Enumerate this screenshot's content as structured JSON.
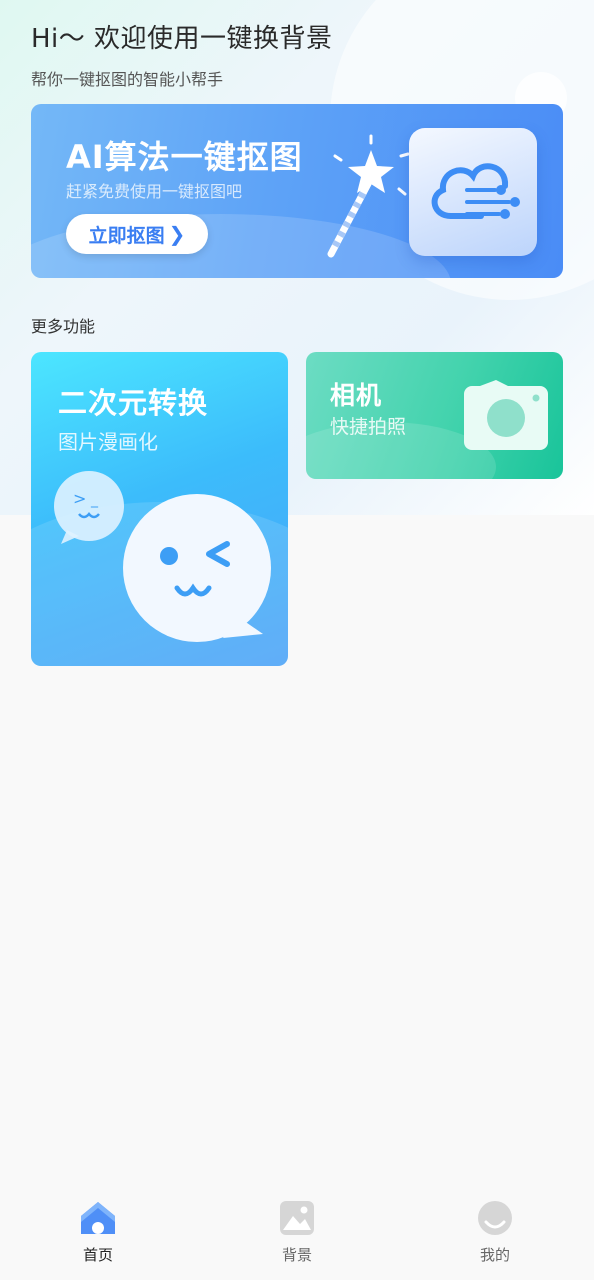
{
  "header": {
    "greeting": "Hi～ 欢迎使用一键换背景",
    "subtitle": "帮你一键抠图的智能小帮手"
  },
  "banner": {
    "title": "AI算法一键抠图",
    "subtitle": "赶紧免费使用一键抠图吧",
    "button_label": "立即抠图",
    "button_icon": "chevron-right-icon"
  },
  "section": {
    "title": "更多功能"
  },
  "cards": [
    {
      "title": "二次元转换",
      "subtitle": "图片漫画化",
      "icon": "chat-bubble-face-icon"
    },
    {
      "title": "相机",
      "subtitle": "快捷拍照",
      "icon": "camera-icon"
    }
  ],
  "tabbar": {
    "items": [
      {
        "label": "首页",
        "icon": "home-icon",
        "active": true
      },
      {
        "label": "背景",
        "icon": "image-icon",
        "active": false
      },
      {
        "label": "我的",
        "icon": "profile-icon",
        "active": false
      }
    ]
  },
  "colors": {
    "banner": "#5ea3f7",
    "anime_card": "#3cbcfb",
    "camera_card": "#43d3ad",
    "tab_active": "#4f8ff7",
    "tab_inactive": "#d6d6d6"
  }
}
